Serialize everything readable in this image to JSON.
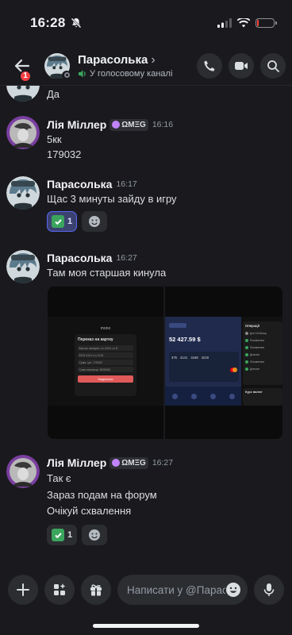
{
  "status": {
    "time": "16:28"
  },
  "header": {
    "unread_count": "1",
    "title": "Парасолька",
    "title_chevron": "›",
    "subtitle": "У голосовому каналі"
  },
  "messages": [
    {
      "id": "m0",
      "author": "Парасолька",
      "lines": [
        "Да"
      ],
      "continued": true
    },
    {
      "id": "m1",
      "author": "Лія Міллер",
      "tag": "ΩMΞG",
      "time": "16:16",
      "lines": [
        "5кк",
        "179032"
      ]
    },
    {
      "id": "m2",
      "author": "Парасолька",
      "time": "16:17",
      "lines": [
        "Щас 3 минуты зайду в игру"
      ],
      "reaction": {
        "emoji": "check-mark",
        "count": "1",
        "mine": true
      }
    },
    {
      "id": "m3",
      "author": "Парасолька",
      "time": "16:27",
      "lines": [
        "Там моя старшая кинула"
      ],
      "attachments": [
        {
          "name": "screenshot-transfer",
          "heading": "mono",
          "title": "Переказ на картку",
          "rows": [
            "Картка, вихідна: •••• 4421 ••• 8",
            "5375 4141 •••• 2•15",
            "Сума, грн: 179032",
            "Сума переказу: 5000000"
          ],
          "button": "Надіслати"
        },
        {
          "name": "screenshot-balance",
          "balance": "52 427.59 $",
          "card_digits": [
            "375",
            "4141",
            "4168",
            "4219"
          ],
          "ops_title": "Операції",
          "ops_items": [
            "Дон Сін Вонщ",
            "Поповнення",
            "Поповнення",
            "Депозит",
            "Поповнення",
            "Депозит"
          ],
          "rates_title": "Курс валют"
        }
      ]
    },
    {
      "id": "m4",
      "author": "Лія Міллер",
      "tag": "ΩMΞG",
      "time": "16:27",
      "lines": [
        "Так є",
        "Зараз подам на форум",
        "Очікуй схвалення"
      ],
      "reaction": {
        "emoji": "check-mark",
        "count": "1",
        "mine": false
      }
    }
  ],
  "composer": {
    "placeholder": "Написати у @Парасолька"
  },
  "colors": {
    "accent": "#5865f2",
    "check": "#3ba55d",
    "badge": "#f23f43",
    "background": "#1a1a1e",
    "battery": "#ff453a",
    "presence_green": "#3ba55d"
  },
  "battery_level": 0.08
}
